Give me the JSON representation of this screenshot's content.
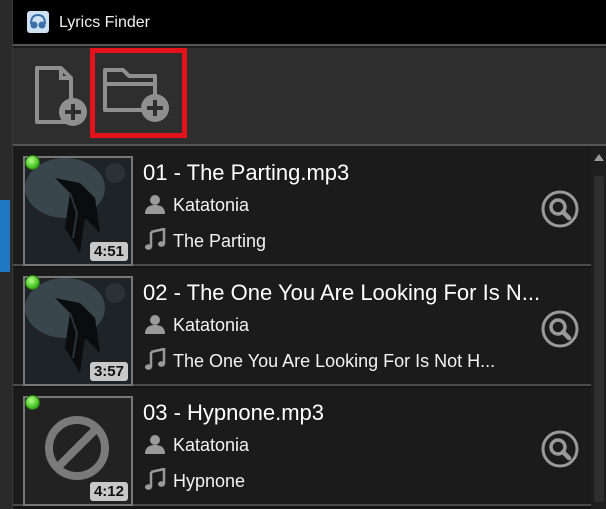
{
  "window": {
    "title": "Lyrics Finder"
  },
  "toolbar": {
    "add_file": "add-file-icon",
    "add_folder": "add-folder-icon",
    "highlight_color": "#e4121b"
  },
  "tracks": [
    {
      "title": "01 - The Parting.mp3",
      "artist": "Katatonia",
      "song": "The Parting",
      "duration": "4:51",
      "has_art": true
    },
    {
      "title": "02 - The One You Are Looking For Is N...",
      "artist": "Katatonia",
      "song": "The One You Are Looking For Is Not H...",
      "duration": "3:57",
      "has_art": true
    },
    {
      "title": "03 - Hypnone.mp3",
      "artist": "Katatonia",
      "song": "Hypnone",
      "duration": "4:12",
      "has_art": false
    }
  ],
  "colors": {
    "status_ok": "#43c124",
    "accent": "#1f78c1"
  }
}
